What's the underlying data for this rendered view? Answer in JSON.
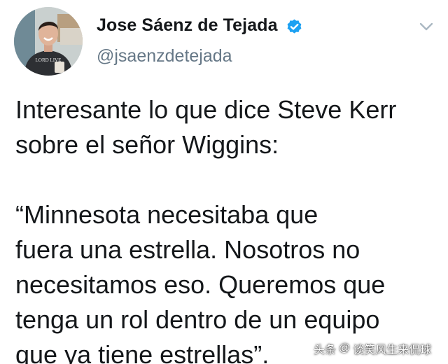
{
  "tweet": {
    "author": {
      "display_name": "Jose Sáenz de Tejada",
      "handle": "@jsaenzdetejada",
      "verified": true,
      "avatar_icon": "avatar-photo",
      "avatar_shirt_text": "LORD LIVE"
    },
    "text_lines": [
      "Interesante lo que dice Steve Kerr",
      "sobre el señor Wiggins:",
      "",
      "“Minnesota necesitaba que",
      "fuera una estrella. Nosotros no",
      "necesitamos eso. Queremos que",
      "tenga un rol dentro de un equipo",
      "que ya tiene estrellas”."
    ],
    "menu_icon": "chevron-down-icon"
  },
  "watermark": {
    "source": "头条",
    "sep": "@",
    "account": "谈笑风生来侃球"
  },
  "colors": {
    "text_primary": "#14171a",
    "text_secondary": "#657786",
    "verified_blue": "#1da1f2",
    "chevron_gray": "#aab8c2",
    "background": "#ffffff"
  }
}
